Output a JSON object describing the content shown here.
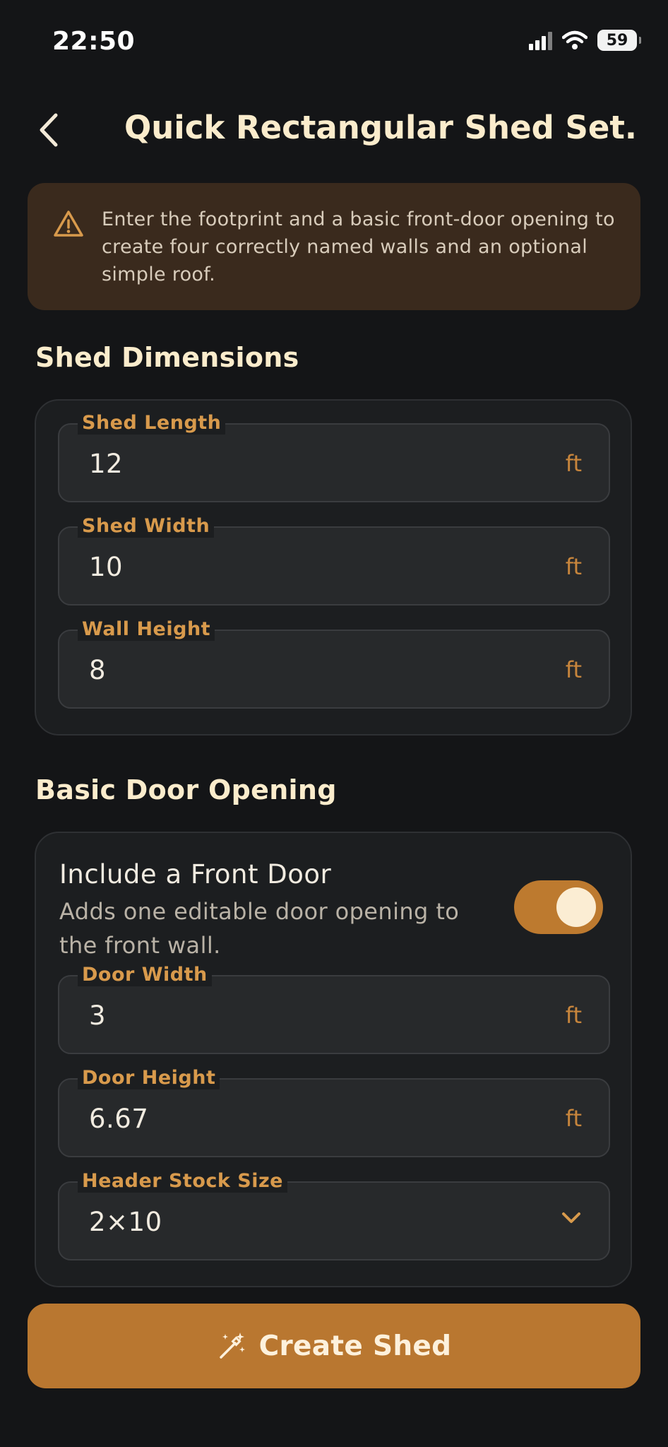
{
  "status_bar": {
    "time": "22:50",
    "battery": "59"
  },
  "header": {
    "title": "Quick Rectangular Shed Set..."
  },
  "banner": {
    "text": "Enter the footprint and a basic front-door opening to create four correctly named walls and an optional simple roof."
  },
  "dimensions": {
    "title": "Shed Dimensions",
    "fields": [
      {
        "label": "Shed Length",
        "value": "12",
        "unit": "ft"
      },
      {
        "label": "Shed Width",
        "value": "10",
        "unit": "ft"
      },
      {
        "label": "Wall Height",
        "value": "8",
        "unit": "ft"
      }
    ]
  },
  "door": {
    "title": "Basic Door Opening",
    "toggle_title": "Include a Front Door",
    "toggle_desc": "Adds one editable door opening to the front wall.",
    "toggle_on": true,
    "fields": [
      {
        "label": "Door Width",
        "value": "3",
        "unit": "ft"
      },
      {
        "label": "Door Height",
        "value": "6.67",
        "unit": "ft"
      }
    ],
    "header_select": {
      "label": "Header Stock Size",
      "value": "2×10"
    }
  },
  "action": {
    "label": "Create Shed"
  },
  "colors": {
    "accent": "#b97730",
    "label": "#d89a4c",
    "background": "#141517",
    "card": "#1c1e20",
    "banner": "#3a2a1d"
  },
  "icons": {
    "back": "chevron-left-icon",
    "warning": "warning-triangle-icon",
    "select": "chevron-down-icon",
    "action": "magic-wand-icon"
  }
}
